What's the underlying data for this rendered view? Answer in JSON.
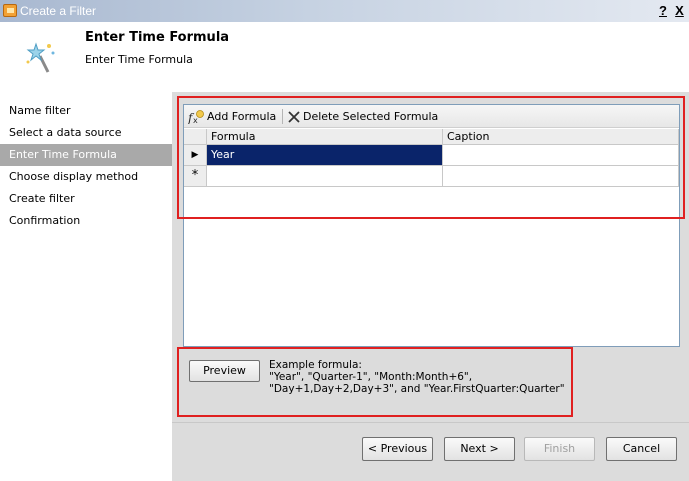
{
  "window": {
    "title": "Create a Filter",
    "help_label": "?",
    "close_label": "X"
  },
  "header": {
    "title": "Enter Time Formula",
    "subtitle": "Enter Time Formula"
  },
  "nav": {
    "items": [
      {
        "label": "Name filter",
        "active": false
      },
      {
        "label": "Select a data source",
        "active": false
      },
      {
        "label": "Enter Time Formula",
        "active": true
      },
      {
        "label": "Choose display method",
        "active": false
      },
      {
        "label": "Create filter",
        "active": false
      },
      {
        "label": "Confirmation",
        "active": false
      }
    ]
  },
  "toolbar": {
    "add_label": "Add Formula",
    "delete_label": "Delete Selected Formula"
  },
  "grid": {
    "columns": [
      "Formula",
      "Caption"
    ],
    "rows": [
      {
        "marker": "▶",
        "formula": "Year",
        "caption": ""
      }
    ],
    "new_row_marker": "*"
  },
  "preview": {
    "button_label": "Preview",
    "example_lines": [
      "Example formula:",
      "\"Year\", \"Quarter-1\", \"Month:Month+6\",",
      "\"Day+1,Day+2,Day+3\", and \"Year.FirstQuarter:Quarter\""
    ]
  },
  "footer": {
    "previous_label": "< Previous",
    "next_label": "Next >",
    "finish_label": "Finish",
    "cancel_label": "Cancel"
  },
  "colors": {
    "highlight": "#e02020",
    "selection": "#0a246a",
    "nav_active": "#a9a9a9"
  }
}
